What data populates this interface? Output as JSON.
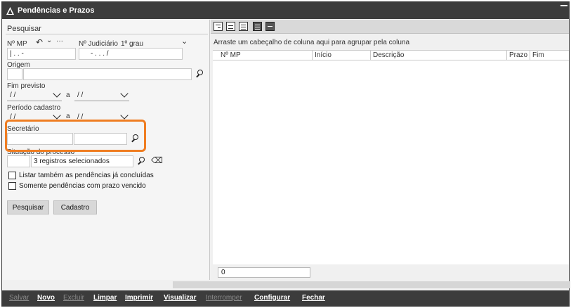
{
  "window": {
    "title": "Pendências e Prazos"
  },
  "search": {
    "title": "Pesquisar",
    "nr_mp_label": "Nº MP",
    "nr_mp_value": "|   .      .     -",
    "nr_jud_label": "Nº Judiciário",
    "nr_jud_instance": "1º grau",
    "nr_jud_value": "-   .     .   .   /",
    "origem_label": "Origem",
    "fim_previsto_label": "Fim previsto",
    "fim_previsto_from": "/ /",
    "fim_previsto_sep": "a",
    "fim_previsto_to": "/ /",
    "periodo_label": "Período cadastro",
    "periodo_from": "/ /",
    "periodo_sep": "a",
    "periodo_to": "/ /",
    "secretario_label": "Secretário",
    "situacao_label": "Situação do processo",
    "situacao_value": "3 registros selecionados",
    "chk_concluidas": "Listar também as pendências já concluídas",
    "chk_vencido": "Somente pendências com prazo vencido",
    "btn_pesquisar": "Pesquisar",
    "btn_cadastro": "Cadastro"
  },
  "grid": {
    "group_hint": "Arraste um cabeçalho de coluna aqui para agrupar pela coluna",
    "columns": [
      "Nº MP",
      "Início",
      "Descrição",
      "Prazo",
      "Fim"
    ],
    "count": "0"
  },
  "bottom_menu": {
    "salvar": "Salvar",
    "novo": "Novo",
    "excluir": "Excluir",
    "limpar": "Limpar",
    "imprimir": "Imprimir",
    "visualizar": "Visualizar",
    "interromper": "Interromper",
    "configurar": "Configurar",
    "fechar": "Fechar"
  },
  "colors": {
    "highlight": "#ef7d22",
    "titlebar": "#3c3c3c"
  }
}
